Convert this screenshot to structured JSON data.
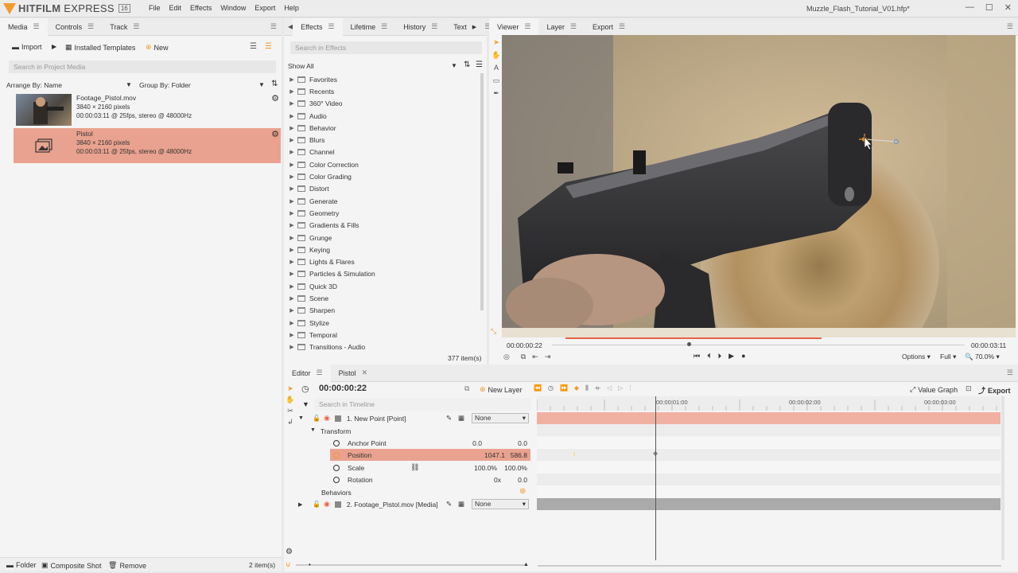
{
  "app": {
    "name_a": "HITFILM",
    "name_b": "EXPRESS",
    "version": "16",
    "document_title": "Muzzle_Flash_Tutorial_V01.hfp*",
    "menu": [
      "File",
      "Edit",
      "Effects",
      "Window",
      "Export",
      "Help"
    ]
  },
  "media_panel": {
    "tabs": [
      "Media",
      "Controls",
      "Track"
    ],
    "import_label": "Import",
    "templates_label": "Installed Templates",
    "new_label": "New",
    "search_placeholder": "Search in Project Media",
    "arrange_label": "Arrange By: Name",
    "group_label": "Group By: Folder",
    "items": [
      {
        "name": "Footage_Pistol.mov",
        "dims": "3840 × 2160 pixels",
        "info": "00:00:03:11 @ 25fps, stereo @ 48000Hz"
      },
      {
        "name": "Pistol",
        "dims": "3840 × 2160 pixels",
        "info": "00:00:03:11 @ 25fps, stereo @ 48000Hz"
      }
    ],
    "folder_label": "Folder",
    "composite_label": "Composite Shot",
    "remove_label": "Remove",
    "count": "2 item(s)"
  },
  "effects_panel": {
    "tabs": [
      "Effects",
      "Lifetime",
      "History",
      "Text"
    ],
    "search_placeholder": "Search in Effects",
    "filter": "Show All",
    "categories": [
      "Favorites",
      "Recents",
      "360° Video",
      "Audio",
      "Behavior",
      "Blurs",
      "Channel",
      "Color Correction",
      "Color Grading",
      "Distort",
      "Generate",
      "Geometry",
      "Gradients & Fills",
      "Grunge",
      "Keying",
      "Lights & Flares",
      "Particles & Simulation",
      "Quick 3D",
      "Scene",
      "Sharpen",
      "Stylize",
      "Temporal",
      "Transitions - Audio"
    ],
    "count": "377 item(s)"
  },
  "viewer_panel": {
    "tabs": [
      "Viewer",
      "Layer",
      "Export"
    ],
    "current_time": "00:00:00:22",
    "end_time": "00:00:03:11",
    "options_label": "Options",
    "quality_label": "Full",
    "zoom_label": "70.0%",
    "playhead_fraction": 0.332
  },
  "editor_panel": {
    "tabs": [
      "Editor",
      "Pistol"
    ],
    "timecode": "00:00:00:22",
    "new_layer_label": "New Layer",
    "value_graph_label": "Value Graph",
    "export_label": "Export",
    "search_placeholder": "Search in Timeline",
    "ruler": [
      "00:00:01:00",
      "00:00:02:00",
      "00:00:03:00"
    ],
    "layer1": {
      "name": "1. New Point [Point]",
      "blend": "None"
    },
    "transform_label": "Transform",
    "properties": [
      {
        "name": "Anchor Point",
        "v1": "0.0",
        "v2": "0.0"
      },
      {
        "name": "Position",
        "v1": "1047.1",
        "v2": "586.8"
      },
      {
        "name": "Scale",
        "v1": "100.0%",
        "v2": "100.0%"
      },
      {
        "name": "Rotation",
        "v1": "0x",
        "v2": "0.0"
      }
    ],
    "behaviors_label": "Behaviors",
    "layer2": {
      "name": "2. Footage_Pistol.mov [Media]",
      "blend": "None"
    }
  },
  "colors": {
    "accent": "#e8a08c",
    "orange": "#f39a2f",
    "selected_row": "#e9a28f"
  }
}
